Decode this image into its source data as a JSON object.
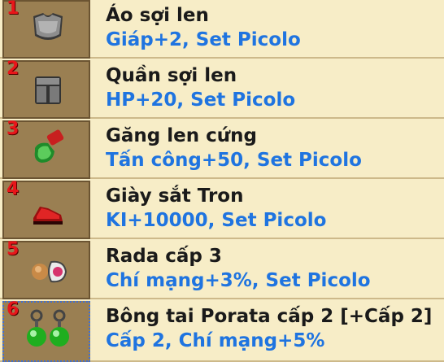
{
  "items": [
    {
      "number": "1",
      "name": "Áo sợi len",
      "stats": "Giáp+2, Set Picolo",
      "icon": "shirt-icon"
    },
    {
      "number": "2",
      "name": "Quần sợi len",
      "stats": "HP+20, Set Picolo",
      "icon": "pants-icon"
    },
    {
      "number": "3",
      "name": "Găng len cứng",
      "stats": "Tấn công+50, Set Picolo",
      "icon": "gloves-icon"
    },
    {
      "number": "4",
      "name": "Giày sắt Tron",
      "stats": "KI+10000, Set Picolo",
      "icon": "shoes-icon"
    },
    {
      "number": "5",
      "name": "Rada cấp 3",
      "stats": "Chí mạng+3%, Set Picolo",
      "icon": "radar-icon"
    },
    {
      "number": "6",
      "name": "Bông tai Porata cấp 2 [+Cấp 2]",
      "stats": "Cấp 2, Chí mạng+5%",
      "icon": "earrings-icon"
    }
  ],
  "colors": {
    "background": "#f7edc7",
    "slot": "#9a7f52",
    "number": "#e8161a",
    "name": "#1a1a1a",
    "stats": "#1f74e0",
    "selection_border": "#3f6fd3"
  }
}
